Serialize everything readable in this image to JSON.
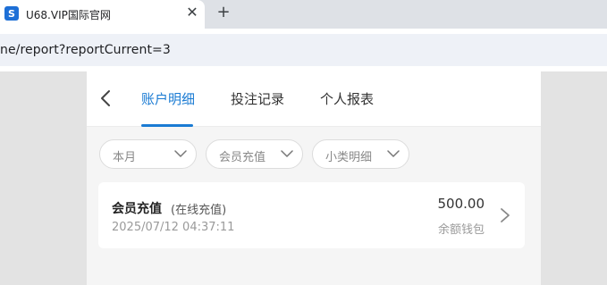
{
  "browser": {
    "tab_title": "U68.VIP国际官网",
    "favicon_letter": "S",
    "close_symbol": "✕",
    "newtab_symbol": "+",
    "url": "ne/report?reportCurrent=3"
  },
  "nav": {
    "tabs": [
      {
        "label": "账户明细",
        "active": true
      },
      {
        "label": "投注记录",
        "active": false
      },
      {
        "label": "个人报表",
        "active": false
      }
    ],
    "accent": "#1a7bd3"
  },
  "filters": [
    {
      "label": "本月"
    },
    {
      "label": "会员充值"
    },
    {
      "label": "小类明细"
    }
  ],
  "records": [
    {
      "title": "会员充值",
      "subtitle": "(在线充值)",
      "time": "2025/07/12 04:37:11",
      "amount": "500.00",
      "wallet": "余额钱包"
    }
  ],
  "icons": {
    "back": "chevron-left-icon",
    "filter": "chevron-down-icon",
    "record": "chevron-right-icon"
  }
}
